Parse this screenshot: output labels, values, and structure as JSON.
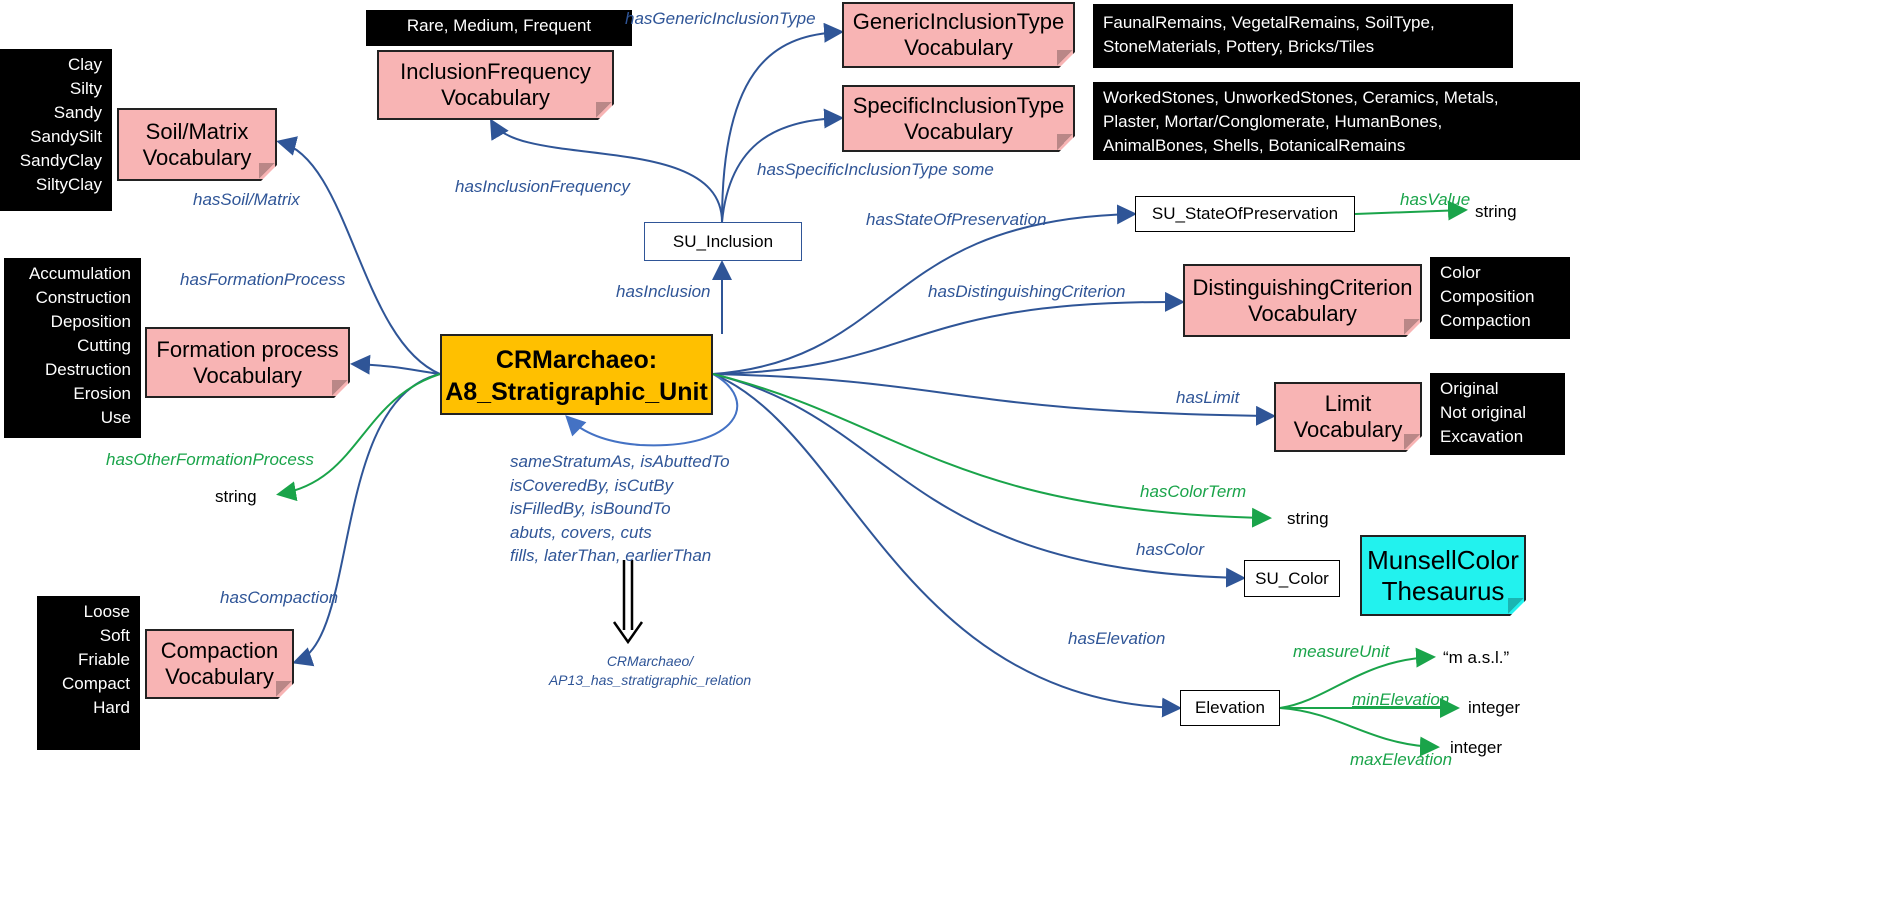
{
  "colors": {
    "edge_blue": "#2f5597",
    "edge_green": "#1aa44a",
    "vocabulary": "#f8b4b4",
    "central": "#ffc000",
    "thesaurus": "#22f2ee",
    "list_bg": "#000000"
  },
  "central": {
    "line1": "CRMarchaeo:",
    "line2": "A8_Stratigraphic_Unit"
  },
  "vocabularies": {
    "soil": {
      "line1": "Soil/Matrix",
      "line2": "Vocabulary",
      "values": [
        "Clay",
        "Silty",
        "Sandy",
        "SandySilt",
        "SandyClay",
        "SiltyClay"
      ]
    },
    "formation": {
      "line1": "Formation process",
      "line2": "Vocabulary",
      "values": [
        "Accumulation",
        "Construction",
        "Deposition",
        "Cutting",
        "Destruction",
        "Erosion",
        "Use"
      ]
    },
    "compaction": {
      "line1": "Compaction",
      "line2": "Vocabulary",
      "values": [
        "Loose",
        "Soft",
        "Friable",
        "Compact",
        "Hard"
      ]
    },
    "frequency": {
      "line1": "InclusionFrequency",
      "line2": "Vocabulary",
      "values": [
        "Rare, Medium, Frequent"
      ]
    },
    "generic": {
      "line1": "GenericInclusionType",
      "line2": "Vocabulary",
      "values": [
        "FaunalRemains, VegetalRemains, SoilType,",
        "StoneMaterials, Pottery, Bricks/Tiles"
      ]
    },
    "specific": {
      "line1": "SpecificInclusionType",
      "line2": "Vocabulary",
      "values": [
        "WorkedStones, UnworkedStones, Ceramics, Metals,",
        "Plaster, Mortar/Conglomerate, HumanBones,",
        "AnimalBones, Shells, BotanicalRemains"
      ]
    },
    "criterion": {
      "line1": "DistinguishingCriterion",
      "line2": "Vocabulary",
      "values": [
        "Color",
        "Composition",
        "Compaction"
      ]
    },
    "limit": {
      "line1": "Limit",
      "line2": "Vocabulary",
      "values": [
        "Original",
        "Not original",
        "Excavation"
      ]
    },
    "munsell": {
      "line1": "MunsellColor",
      "line2": "Thesaurus"
    }
  },
  "classes": {
    "inclusion": "SU_Inclusion",
    "preservation": "SU_StateOfPreservation",
    "color": "SU_Color",
    "elevation": "Elevation"
  },
  "literals": {
    "string": "string",
    "masl": "“m a.s.l.”",
    "integer": "integer"
  },
  "edges": {
    "hasGenericInclusionType": "hasGenericInclusionType",
    "hasSpecificInclusionType": "hasSpecificInclusionType some",
    "hasInclusionFrequency": "hasInclusionFrequency",
    "hasSoilMatrix": "hasSoil/Matrix",
    "hasFormationProcess": "hasFormationProcess",
    "hasInclusion": "hasInclusion",
    "hasStateOfPreservation": "hasStateOfPreservation",
    "hasValue": "hasValue",
    "hasDistinguishingCriterion": "hasDistinguishingCriterion",
    "hasLimit": "hasLimit",
    "hasOtherFormationProcess": "hasOtherFormationProcess",
    "hasColorTerm": "hasColorTerm",
    "hasColor": "hasColor",
    "hasCompaction": "hasCompaction",
    "hasElevation": "hasElevation",
    "measureUnit": "measureUnit",
    "minElevation": "minElevation",
    "maxElevation": "maxElevation"
  },
  "stratigraphic": {
    "relations": [
      "sameStratumAs, isAbuttedTo",
      "isCoveredBy, isCutBy",
      "isFilledBy, isBoundTo",
      "abuts, covers, cuts",
      "fills, laterThan, earlierThan"
    ],
    "super_line1": "CRMarchaeo/",
    "super_line2": "AP13_has_stratigraphic_relation"
  }
}
